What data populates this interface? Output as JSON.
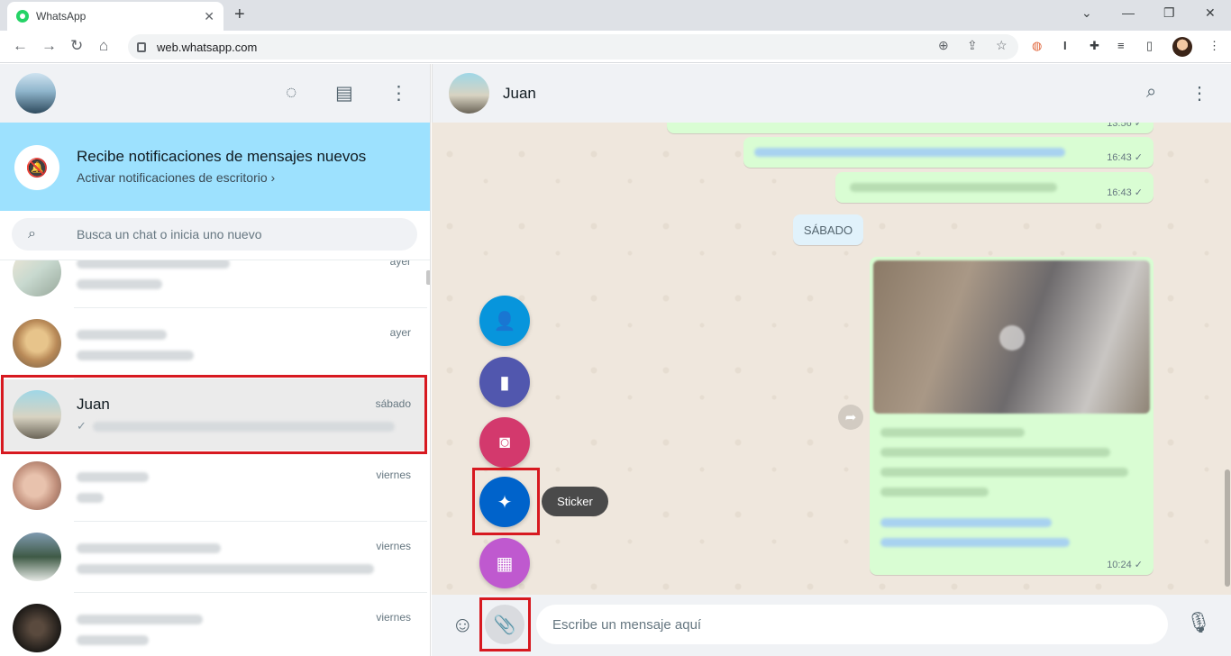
{
  "browser": {
    "tab_title": "WhatsApp",
    "url": "web.whatsapp.com"
  },
  "sidebar": {
    "notification": {
      "title": "Recibe notificaciones de mensajes nuevos",
      "subtitle": "Activar notificaciones de escritorio ›"
    },
    "search": {
      "placeholder": "Busca un chat o inicia uno nuevo"
    },
    "chats": [
      {
        "name": "",
        "time": "ayer"
      },
      {
        "name": "",
        "time": "ayer"
      },
      {
        "name": "Juan",
        "time": "sábado",
        "selected": true
      },
      {
        "name": "",
        "time": "viernes"
      },
      {
        "name": "",
        "time": "viernes"
      },
      {
        "name": "",
        "time": "viernes"
      }
    ]
  },
  "conversation": {
    "contact_name": "Juan",
    "day_separator": "SÁBADO",
    "messages": [
      {
        "time": "13:56"
      },
      {
        "time": "16:43"
      },
      {
        "time": "16:43"
      },
      {
        "time": "10:24",
        "type": "video"
      }
    ],
    "attach_menu": {
      "tooltip": "Sticker",
      "items": [
        "contact",
        "document",
        "camera",
        "sticker",
        "photos-videos"
      ]
    },
    "composer": {
      "placeholder": "Escribe un mensaje aquí"
    }
  },
  "colors": {
    "accent_green": "#25d366",
    "notification_bg": "#9de1fe",
    "outgoing_bubble": "#d9fdd3",
    "highlight_red": "#d71920",
    "fab_contact": "#0795dc",
    "fab_document": "#5157ae",
    "fab_camera": "#d3396d",
    "fab_sticker": "#0063cb",
    "fab_photos": "#bf59cf"
  }
}
